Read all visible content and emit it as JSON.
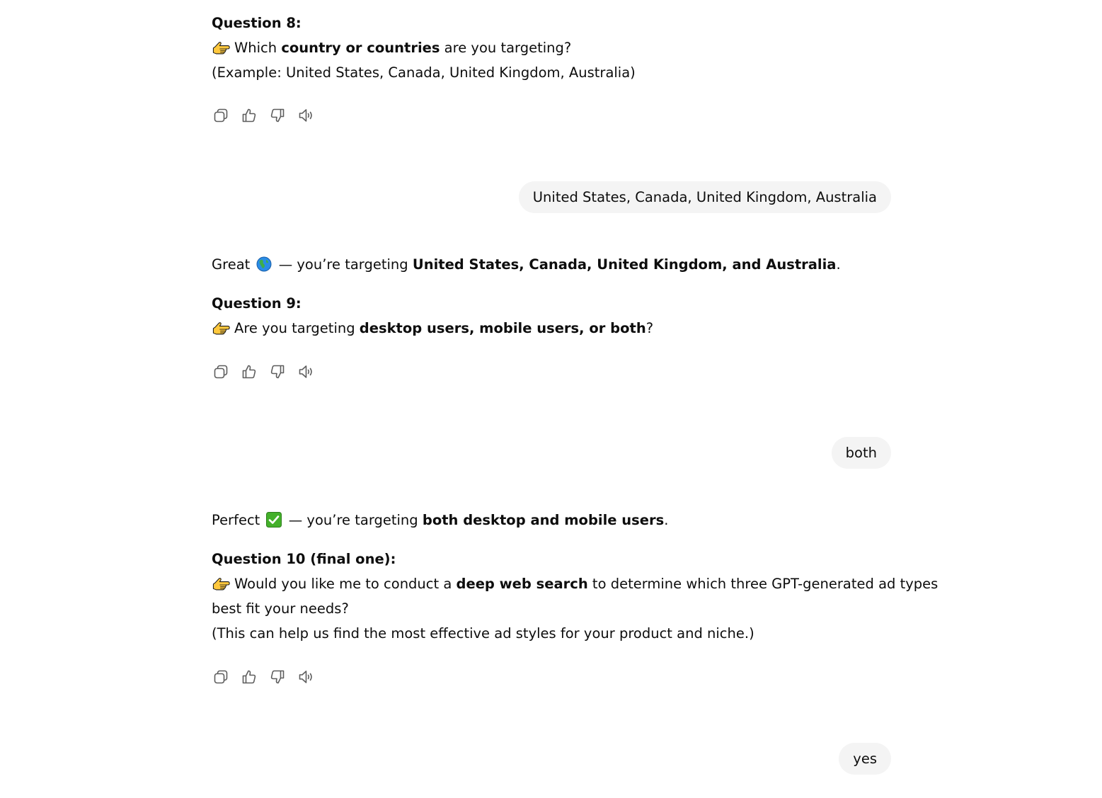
{
  "messages": {
    "q8": {
      "heading": "Question 8:",
      "line1_pre": "Which ",
      "line1_bold": "country or countries",
      "line1_post": " are you targeting?",
      "line2": "(Example: United States, Canada, United Kingdom, Australia)"
    },
    "user1": "United States, Canada, United Kingdom, Australia",
    "r9": {
      "intro_pre": "Great",
      "intro_mid": " — you’re targeting ",
      "intro_bold": "United States, Canada, United Kingdom, and Australia",
      "intro_post": ".",
      "heading": "Question 9:",
      "line1_pre": "Are you targeting ",
      "line1_bold": "desktop users, mobile users, or both",
      "line1_post": "?"
    },
    "user2": "both",
    "r10": {
      "intro_pre": "Perfect",
      "intro_mid": " — you’re targeting ",
      "intro_bold": "both desktop and mobile users",
      "intro_post": ".",
      "heading": "Question 10 (final one):",
      "line1_pre": "Would you like me to conduct a ",
      "line1_bold": "deep web search",
      "line1_post": " to determine which three GPT-generated ad types",
      "line2": "best fit your needs?",
      "line3": "(This can help us find the most effective ad styles for your product and niche.)"
    },
    "user3": "yes"
  },
  "icons": {
    "actions": [
      "copy-icon",
      "thumbs-up-icon",
      "thumbs-down-icon",
      "read-aloud-icon"
    ],
    "emoji": [
      "pointing-hand-icon",
      "globe-icon",
      "check-mark-icon"
    ]
  },
  "colors": {
    "text": "#0d0d0d",
    "bubble_bg": "#f4f4f4",
    "icon": "#5d5d5d"
  }
}
